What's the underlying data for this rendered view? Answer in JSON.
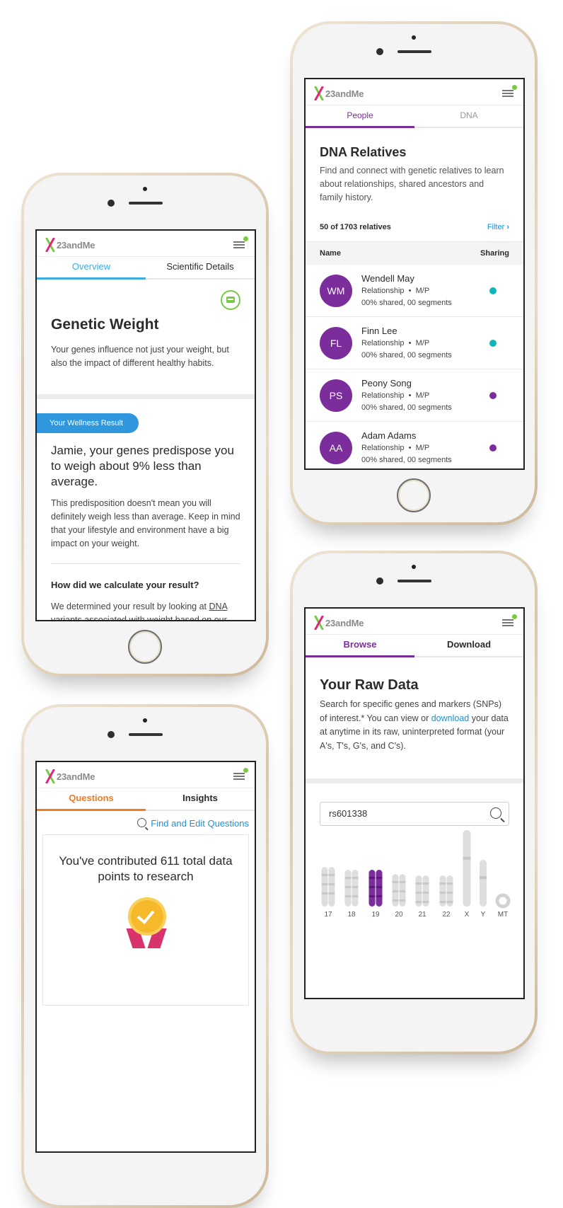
{
  "brand": {
    "logo_text": "23andMe"
  },
  "colors": {
    "blue": "#3aaee0",
    "purple": "#7b2d9c",
    "orange": "#f47b20",
    "teal": "#11b5b3",
    "green": "#7ac943",
    "link": "#1d92d4"
  },
  "weight": {
    "tabs": [
      "Overview",
      "Scientific Details"
    ],
    "title": "Genetic Weight",
    "intro": "Your genes influence not just your weight, but also the impact of different healthy habits.",
    "badge": "Your Wellness Result",
    "result": "Jamie, your genes predispose you to weigh about 9% less than average.",
    "explain": "This predisposition doesn't mean you will definitely weigh less than average. Keep in mind that your lifestyle and environment have a big impact on your weight.",
    "calc_heading": "How did we calculate your result?",
    "calc_text_start": "We determined your result by looking at ",
    "calc_link": "DNA",
    "calc_text_end": " variants associated with weight based on our"
  },
  "relatives": {
    "tabs": [
      "People",
      "DNA"
    ],
    "title": "DNA Relatives",
    "intro": "Find and connect with genetic relatives to learn about relationships, shared ancestors and family history.",
    "count": "50 of 1703 relatives",
    "filter": "Filter",
    "col_name": "Name",
    "col_sharing": "Sharing",
    "rows": [
      {
        "initials": "WM",
        "name": "Wendell May",
        "rel": "Relationship",
        "side": "M/P",
        "shared": "00% shared, 00 segments",
        "dot": "#11b5b3"
      },
      {
        "initials": "FL",
        "name": "Finn Lee",
        "rel": "Relationship",
        "side": "M/P",
        "shared": "00% shared, 00 segments",
        "dot": "#11b5b3"
      },
      {
        "initials": "PS",
        "name": "Peony Song",
        "rel": "Relationship",
        "side": "M/P",
        "shared": "00% shared, 00 segments",
        "dot": "#7b2d9c"
      },
      {
        "initials": "AA",
        "name": "Adam Adams",
        "rel": "Relationship",
        "side": "M/P",
        "shared": "00% shared, 00 segments",
        "dot": "#7b2d9c"
      }
    ]
  },
  "questions": {
    "tabs": [
      "Questions",
      "Insights"
    ],
    "find_link": "Find and Edit Questions",
    "contributed": "You've contributed 611 total data points to research"
  },
  "raw": {
    "tabs": [
      "Browse",
      "Download"
    ],
    "title": "Your Raw Data",
    "text1": "Search for specific genes and markers (SNPs) of interest.* You can view or ",
    "download_link": "download",
    "text2": " your data at anytime in its raw, uninterpreted format (your A's, T's, G's, and C's).",
    "search_value": "rs601338",
    "chromosomes": [
      "17",
      "18",
      "19",
      "20",
      "21",
      "22",
      "X",
      "Y",
      "MT"
    ],
    "selected_chromosome": "19"
  }
}
